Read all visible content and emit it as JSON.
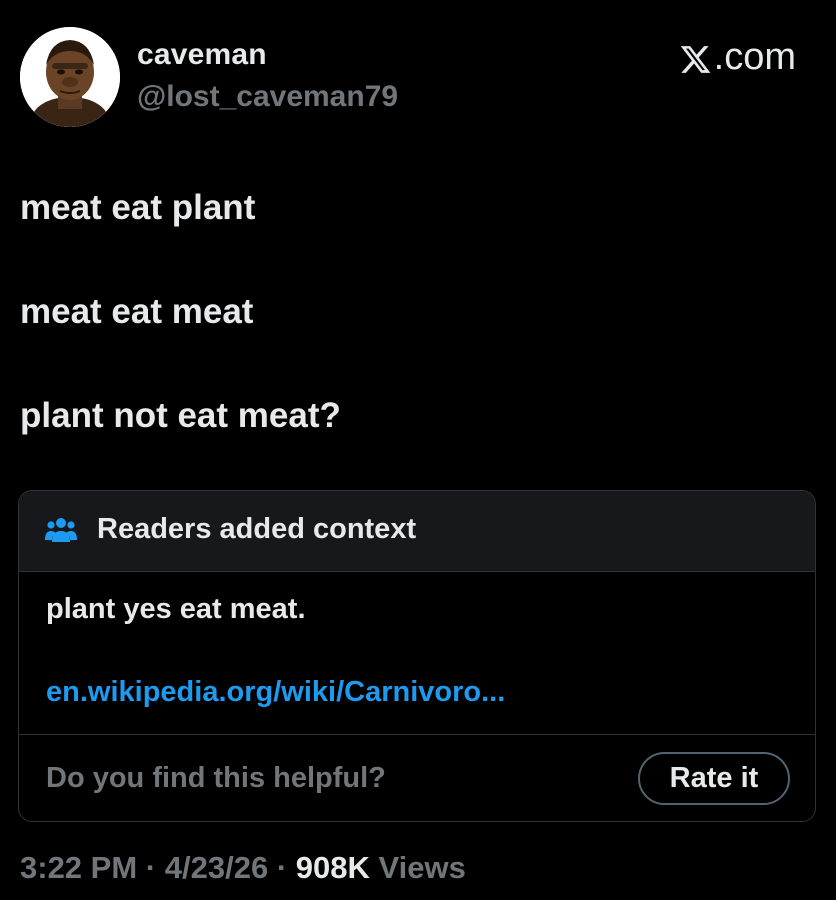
{
  "author": {
    "display_name": "caveman",
    "handle": "@lost_caveman79",
    "avatar_icon": "caveman-avatar-icon"
  },
  "brand": {
    "logo_icon": "x-logo-icon",
    "suffix": ".com"
  },
  "tweet": {
    "lines": [
      "meat eat plant",
      "meat eat meat",
      "plant not eat meat?"
    ]
  },
  "context": {
    "icon": "people-icon",
    "title": "Readers added context",
    "note": "plant yes eat meat.",
    "link": "en.wikipedia.org/wiki/Carnivoro...",
    "helpful_question": "Do you find this helpful?",
    "rate_button": "Rate it"
  },
  "meta": {
    "time": "3:22 PM",
    "separator": "·",
    "date": "4/23/26",
    "views_count": "908K",
    "views_label": "Views"
  },
  "colors": {
    "background": "#000000",
    "primary_text": "#e7e9ea",
    "secondary_text": "#71767b",
    "link": "#1d9bf0",
    "border": "#2f3336",
    "context_header_bg": "#16181c"
  }
}
